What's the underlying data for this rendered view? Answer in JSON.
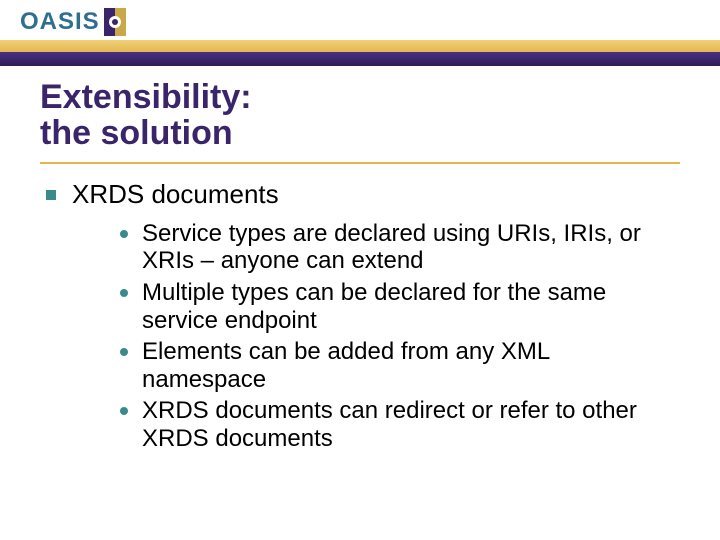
{
  "logo": {
    "text": "OASIS"
  },
  "title": {
    "line1": "Extensibility:",
    "line2": "the solution"
  },
  "body": {
    "heading": "XRDS documents",
    "items": [
      "Service types are declared using URIs, IRIs, or XRIs – anyone can extend",
      "Multiple types can be declared for the same service endpoint",
      "Elements can be added from any XML namespace",
      "XRDS documents can redirect or refer to other XRDS documents"
    ]
  }
}
